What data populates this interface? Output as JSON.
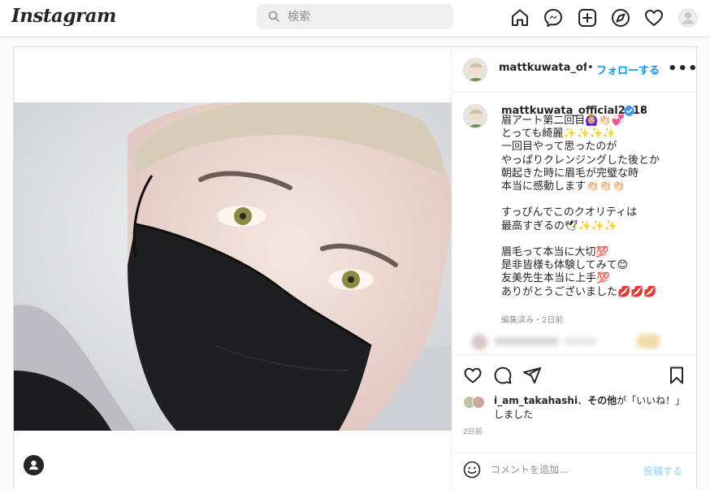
{
  "header": {
    "logo": "Instagram",
    "search_placeholder": "検索",
    "icons": [
      "home-icon",
      "messenger-icon",
      "new-post-icon",
      "explore-icon",
      "activity-heart-icon",
      "profile-avatar"
    ]
  },
  "post": {
    "author_short": "mattkuwata_offici",
    "dot": "•",
    "follow_label": "フォローする",
    "more_label": "•••",
    "caption_author": "mattkuwata_official2018",
    "verified": true,
    "caption_lines": [
      "眉アート第二回目🙆🏼‍♀️👏🏻💞",
      "とっても綺麗✨✨✨✨",
      "一回目やって思ったのが",
      "やっぱりクレンジングした後とか",
      "朝起きた時に眉毛が完璧な時",
      "本当に感動します👏🏻👏🏻👏🏻",
      "",
      "すっぴんでこのクオリティは",
      "最高すぎるの🕊✨✨✨",
      "",
      "眉毛って本当に大切💯",
      "是非皆様も体験してみて😊",
      "友美先生本当に上手💯",
      "ありがとうございました💋💋💋"
    ],
    "caption_meta": "編集済み・2日前",
    "likes_user": "i_am_takahashi",
    "likes_sep": "、",
    "likes_others": "その他",
    "likes_tail": "が「いいね！」しました",
    "time_ago": "2日前",
    "comment_placeholder": "コメントを追加...",
    "post_button": "投稿する"
  },
  "colors": {
    "accent": "#0095f6",
    "post_button_disabled": "#b2dffc",
    "verified": "#3897f0",
    "border": "#dbdbdb"
  }
}
